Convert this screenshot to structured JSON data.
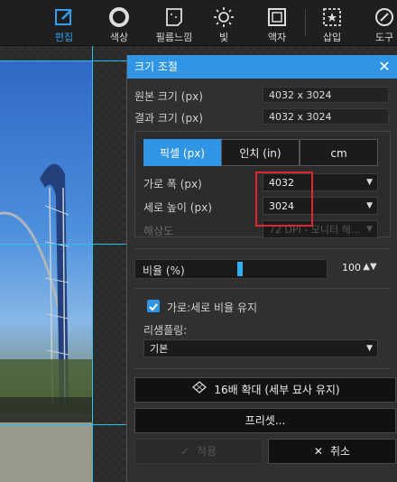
{
  "toolbar": {
    "items": [
      {
        "label": "편집",
        "icon": "edit-icon",
        "active": true
      },
      {
        "label": "색상",
        "icon": "color-circle-icon"
      },
      {
        "label": "필름느낌",
        "icon": "film-icon"
      },
      {
        "label": "빛",
        "icon": "sun-icon"
      },
      {
        "label": "액자",
        "icon": "frame-icon"
      },
      {
        "label": "삽입",
        "icon": "insert-star-icon"
      },
      {
        "label": "도구",
        "icon": "tools-icon"
      }
    ]
  },
  "dialog": {
    "title": "크기 조절",
    "original_size_label": "원본 크기 (px)",
    "original_size_value": "4032 x 3024",
    "result_size_label": "결과 크기 (px)",
    "result_size_value": "4032 x 3024",
    "units": [
      "픽셀 (px)",
      "인치 (in)",
      "cm"
    ],
    "active_unit": "픽셀 (px)",
    "width_label": "가로 폭 (px)",
    "width_value": "4032",
    "height_label": "세로 높이 (px)",
    "height_value": "3024",
    "resolution_label": "해상도",
    "resolution_value": "72 DPI - 모니터 해...",
    "ratio_label": "비율 (%)",
    "ratio_value": "100",
    "ratio_percent": 100,
    "keep_ratio_label": "가로:세로 비율 유지",
    "keep_ratio_checked": true,
    "resampling_label": "리샘플링:",
    "resampling_value": "기본",
    "upscale_button": "16배 확대 (세부 묘사 유지)",
    "preset_button": "프리셋...",
    "apply_button": "적용",
    "cancel_button": "취소"
  },
  "colors": {
    "accent": "#2f95e4",
    "highlight": "#e0262b",
    "slider": "#2fb0f0"
  }
}
